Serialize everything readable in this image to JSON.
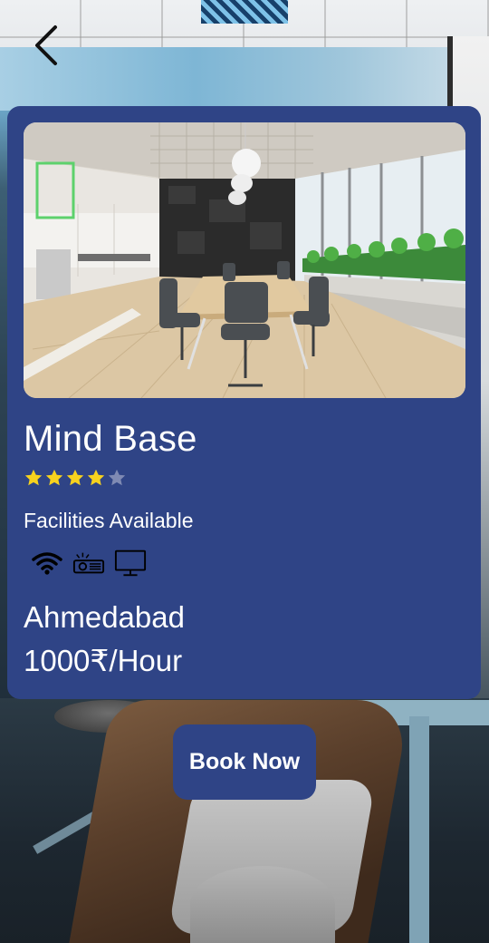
{
  "venue": {
    "name": "Mind Base",
    "rating": 4,
    "rating_max": 5,
    "facilities_label": "Facilities Available",
    "facilities": [
      {
        "icon": "wifi-icon"
      },
      {
        "icon": "projector-icon"
      },
      {
        "icon": "monitor-icon"
      }
    ],
    "city": "Ahmedabad",
    "price": "1000₹/Hour"
  },
  "actions": {
    "book_label": "Book Now"
  },
  "colors": {
    "card": "#2f4486",
    "star_filled": "#f7d21e",
    "star_empty": "#7f8ab3",
    "text": "#ffffff"
  }
}
